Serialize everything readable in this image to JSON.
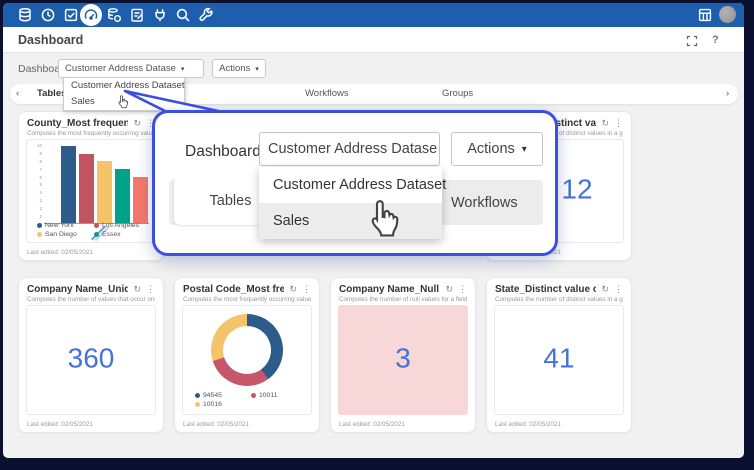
{
  "topnav": {
    "icons": [
      "database-icon",
      "clock-icon",
      "check-square-icon",
      "gauge-icon",
      "datasets-icon",
      "checklist-icon",
      "plug-icon",
      "search-icon",
      "wrench-icon"
    ],
    "active_icon": "gauge-icon",
    "right_icons": [
      "calculator-icon",
      "avatar"
    ]
  },
  "titlebar": {
    "title": "Dashboard",
    "help_label": "?"
  },
  "breadcrumb": {
    "label": "Dashboard",
    "dataset_selector_value": "Customer Address Datase",
    "actions_label": "Actions",
    "caret": "▾"
  },
  "dropdown": {
    "items": [
      "Customer Address Dataset",
      "Sales"
    ],
    "hovered": "Sales"
  },
  "tabs": {
    "left_chevron": "‹",
    "right_chevron": "›",
    "items": [
      "Tables",
      "Workflows",
      "Groups"
    ],
    "active": "Tables"
  },
  "overlay": {
    "dashboard_label": "Dashboard",
    "selector_value": "Customer Address Datase",
    "actions_label": "Actions",
    "caret": "▾",
    "tabs": [
      "Tables",
      "Workflows"
    ],
    "menu_items": [
      "Customer Address Dataset",
      "Sales"
    ],
    "hovered_item": "Sales"
  },
  "cards": {
    "top_row": [
      {
        "title": "County_Most frequent values",
        "subtitle": "Computes the most frequently occurring values for ...",
        "footer": "Last edited: 02/05/2021"
      },
      {
        "title": "City_Distinct value ...",
        "subtitle": "Computes the number of distinct values in a given ...",
        "value": "12",
        "footer": "Last edited: 02/05/2021"
      }
    ],
    "bottom_row": [
      {
        "title": "Company Name_Unique co...",
        "subtitle": "Computes the number of values that occur only once.",
        "value": "360",
        "footer": "Last edited: 02/05/2021"
      },
      {
        "title": "Postal Code_Most frequent...",
        "subtitle": "Computes the most frequently occurring values for ...",
        "footer": "Last edited: 02/05/2021"
      },
      {
        "title": "Company Name_Null count",
        "subtitle": "Computes the number of null values for a field.",
        "value": "3",
        "footer": "Last edited: 02/05/2021"
      },
      {
        "title": "State_Distinct value count",
        "subtitle": "Computes the number of distinct values in a given ...",
        "value": "41",
        "footer": "Last edited: 02/05/2021"
      }
    ]
  },
  "chart_data": [
    {
      "type": "bar",
      "title": "County_Most frequent values",
      "categories": [
        "New York",
        "Los Angeles",
        "San Diego",
        "Essex",
        ""
      ],
      "values": [
        10,
        9,
        8,
        7,
        6
      ],
      "colors": [
        "#2e5c8a",
        "#c0545f",
        "#f5c36a",
        "#00a289",
        "#f4796b"
      ],
      "legend": [
        {
          "label": "New York",
          "color": "#2e5c8a"
        },
        {
          "label": "Los Angeles",
          "color": "#c0545f"
        },
        {
          "label": "San Diego",
          "color": "#f5c36a"
        },
        {
          "label": "Essex",
          "color": "#00a289"
        }
      ],
      "ylim": [
        0,
        10
      ],
      "ytick_step": 1,
      "grid": false,
      "legend_position": "bottom"
    },
    {
      "type": "pie",
      "title": "Postal Code_Most frequent...",
      "labels": [
        "94545",
        "10011",
        "10016"
      ],
      "values_pct": [
        40,
        30,
        30
      ],
      "colors": [
        "#2e5c8a",
        "#c5566b",
        "#f5c36a"
      ],
      "donut": true,
      "legend_position": "bottom"
    }
  ],
  "colors": {
    "topbar_blue": "#1e5fad",
    "callout_blue": "#3a4fe4",
    "metric_blue": "#4472d8",
    "null_highlight": "#f8d7d9",
    "content_bg": "#f1f1f1",
    "frame": "#0a1130"
  }
}
